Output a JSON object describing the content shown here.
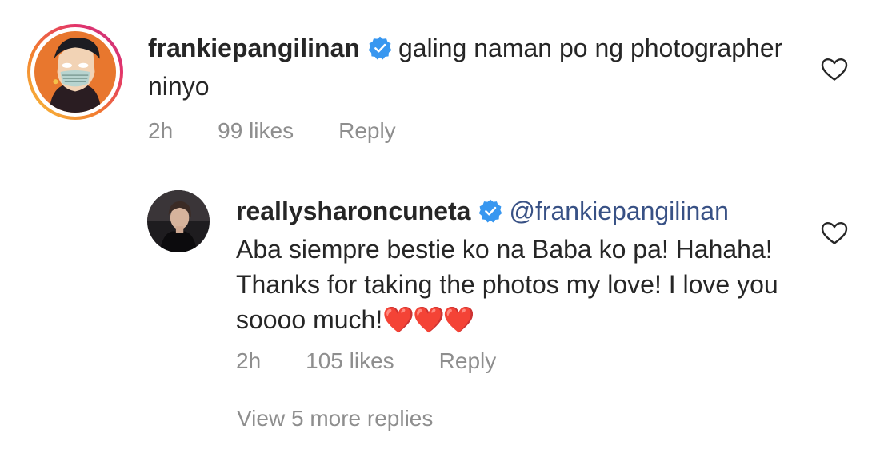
{
  "comments": [
    {
      "username": "frankiepangilinan",
      "verified": true,
      "text": "galing naman po ng photographer ninyo",
      "time": "2h",
      "likes": "99 likes",
      "reply_label": "Reply",
      "avatar_has_story_ring": true
    },
    {
      "username": "reallysharoncuneta",
      "verified": true,
      "mention": "@frankiepangilinan",
      "text": "Aba siempre bestie ko na Baba ko pa! Hahaha! Thanks for taking the photos my love! I love you soooo much!",
      "emoji": "❤️❤️❤️",
      "time": "2h",
      "likes": "105 likes",
      "reply_label": "Reply"
    }
  ],
  "view_more_replies": "View 5 more replies",
  "colors": {
    "text": "#262626",
    "secondary": "#8e8e8e",
    "verified": "#3897f0",
    "mention": "#385185",
    "heart": "#e0245e"
  }
}
